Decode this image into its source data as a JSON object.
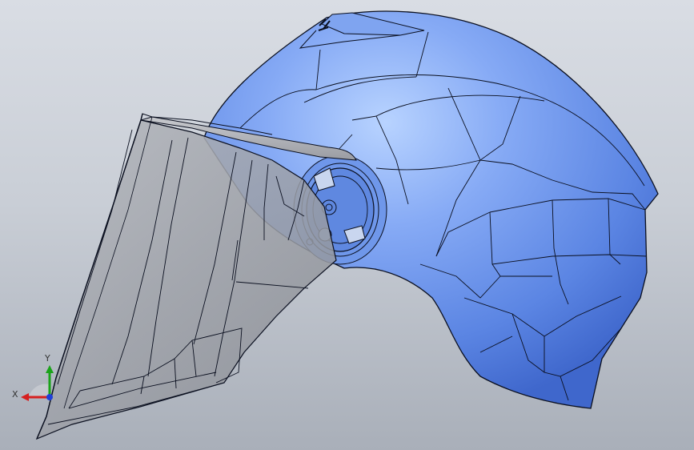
{
  "app": {
    "type": "cad-3d-viewport",
    "model": "helmet-with-visor"
  },
  "triad": {
    "x_label": "X",
    "y_label": "Y"
  },
  "colors": {
    "shell_light": "#a9c8ff",
    "shell_mid": "#6d98ee",
    "shell_dark": "#3f6ad0",
    "visor_fill": "#9a9da4",
    "edge": "#0a0f1f",
    "axis_x": "#d62020",
    "axis_y": "#1aa31a",
    "axis_z": "#1e3fd8"
  },
  "icons": {
    "triad": "coordinate-triad-icon"
  }
}
